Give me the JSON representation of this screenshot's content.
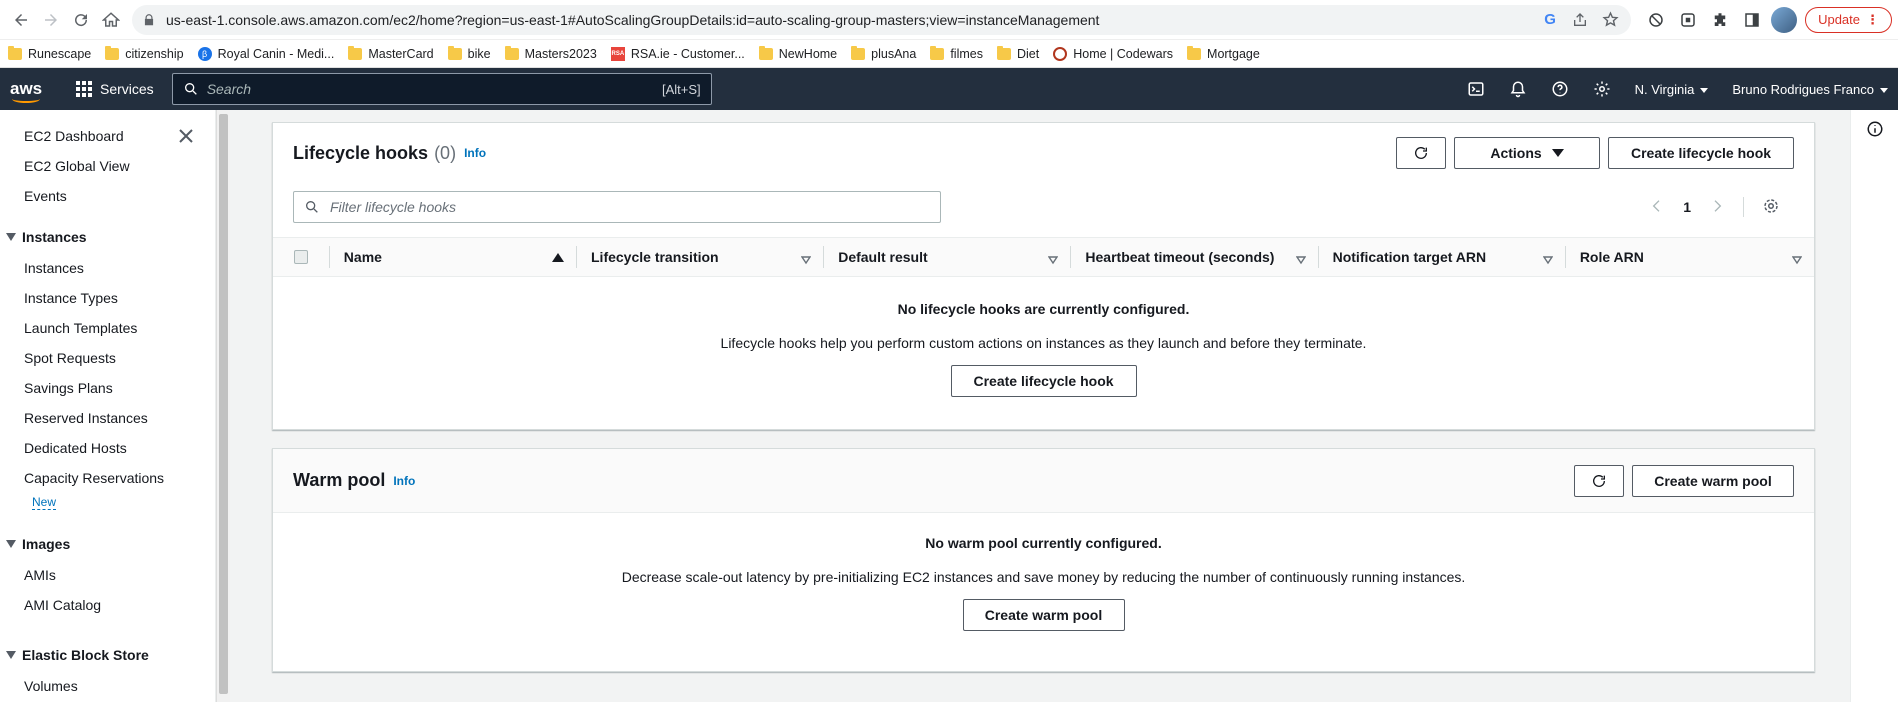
{
  "browser": {
    "url": "us-east-1.console.aws.amazon.com/ec2/home?region=us-east-1#AutoScalingGroupDetails:id=auto-scaling-group-masters;view=instanceManagement",
    "update_label": "Update",
    "bookmarks": [
      {
        "label": "Runescape",
        "icon": "folder"
      },
      {
        "label": "citizenship",
        "icon": "folder"
      },
      {
        "label": "Royal Canin - Medi...",
        "icon": "royal-canin"
      },
      {
        "label": "MasterCard",
        "icon": "folder"
      },
      {
        "label": "bike",
        "icon": "folder"
      },
      {
        "label": "Masters2023",
        "icon": "folder"
      },
      {
        "label": "RSA.ie - Customer...",
        "icon": "rsa"
      },
      {
        "label": "NewHome",
        "icon": "folder"
      },
      {
        "label": "plusAna",
        "icon": "folder"
      },
      {
        "label": "filmes",
        "icon": "folder"
      },
      {
        "label": "Diet",
        "icon": "folder"
      },
      {
        "label": "Home | Codewars",
        "icon": "codewars"
      },
      {
        "label": "Mortgage",
        "icon": "folder"
      }
    ]
  },
  "aws": {
    "logo": "aws",
    "services_label": "Services",
    "search_placeholder": "Search",
    "search_shortcut": "[Alt+S]",
    "region": "N. Virginia",
    "user": "Bruno Rodrigues Franco"
  },
  "sidebar": {
    "top_items": [
      "EC2 Dashboard",
      "EC2 Global View",
      "Events"
    ],
    "sections": [
      {
        "title": "Instances",
        "items": [
          "Instances",
          "Instance Types",
          "Launch Templates",
          "Spot Requests",
          "Savings Plans",
          "Reserved Instances",
          "Dedicated Hosts",
          "Capacity Reservations"
        ]
      },
      {
        "title": "Images",
        "items": [
          "AMIs",
          "AMI Catalog"
        ]
      },
      {
        "title": "Elastic Block Store",
        "items": [
          "Volumes"
        ]
      }
    ],
    "new_badge": "New"
  },
  "lifecycle": {
    "title": "Lifecycle hooks",
    "count": "(0)",
    "info": "Info",
    "actions_label": "Actions",
    "create_label": "Create lifecycle hook",
    "filter_placeholder": "Filter lifecycle hooks",
    "page": "1",
    "columns": [
      "Name",
      "Lifecycle transition",
      "Default result",
      "Heartbeat timeout (seconds)",
      "Notification target ARN",
      "Role ARN"
    ],
    "empty_title": "No lifecycle hooks are currently configured.",
    "empty_desc": "Lifecycle hooks help you perform custom actions on instances as they launch and before they terminate.",
    "empty_button": "Create lifecycle hook"
  },
  "warmpool": {
    "title": "Warm pool",
    "info": "Info",
    "create_label": "Create warm pool",
    "empty_title": "No warm pool currently configured.",
    "empty_desc": "Decrease scale-out latency by pre-initializing EC2 instances and save money by reducing the number of continuously running instances.",
    "empty_button": "Create warm pool"
  }
}
